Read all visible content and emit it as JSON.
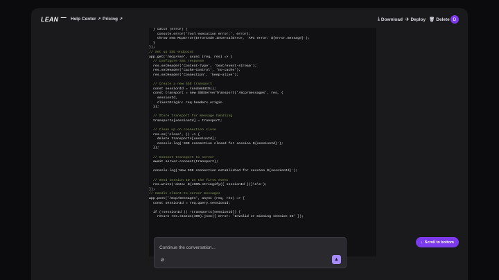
{
  "brand": {
    "logo_text": "LEAN"
  },
  "nav": {
    "help_center": "Help Center",
    "pricing": "Pricing",
    "external_glyph": "↗"
  },
  "actions": {
    "download": "Download",
    "deploy": "Deploy",
    "delete": "Delete"
  },
  "user": {
    "avatar_initial": "D"
  },
  "code_lines": [
    "  } catch (error) {",
    "    console.error('Tool execution error:', error);",
    "    throw new McpError(ErrorCode.InternalError, `API error: ${error.message}`);",
    "  }",
    "});",
    "// Set up SSE endpoint",
    "app.get('/mcp/sse', async (req, res) => {",
    "  // Configure SSE response",
    "  res.setHeader('Content-Type', 'text/event-stream');",
    "  res.setHeader('Cache-Control', 'no-cache');",
    "  res.setHeader('Connection', 'keep-alive');",
    "",
    "  // Create a new SSE transport",
    "  const sessionId = randomUUID();",
    "  const transport = new SSEServerTransport('/mcp/messages', res, {",
    "    sessionId,",
    "    clientOrigin: req.headers.origin",
    "  });",
    "",
    "  // Store transport for message handling",
    "  transports[sessionId] = transport;",
    "",
    "  // Clean up on connection close",
    "  res.on('close', () => {",
    "    delete transports[sessionId];",
    "    console.log(`SSE connection closed for session ${sessionId}`);",
    "  });",
    "",
    "  // Connect transport to server",
    "  await server.connect(transport);",
    "",
    "  console.log(`New SSE connection established for session ${sessionId}`);",
    "",
    "  // Send session ID as the first event",
    "  res.write(`data: ${JSON.stringify({ sessionId })}\\n\\n`);",
    "});",
    "// Handle client-to-server messages",
    "app.post('/mcp/messages', async (req, res) => {",
    "  const sessionId = req.query.sessionId;",
    "",
    "  if (!sessionId || !transports[sessionId]) {",
    "    return res.status(400).json({ error: 'Invalid or missing session ID' });"
  ],
  "chat": {
    "placeholder": "Continue the conversation..."
  },
  "scroll_button": {
    "label": "Scroll to bottom",
    "icon": "↓"
  },
  "colors": {
    "accent": "#7c3aed",
    "send_button": "#a78bfa",
    "background": "#1a1a1d",
    "code_background": "#111113"
  }
}
